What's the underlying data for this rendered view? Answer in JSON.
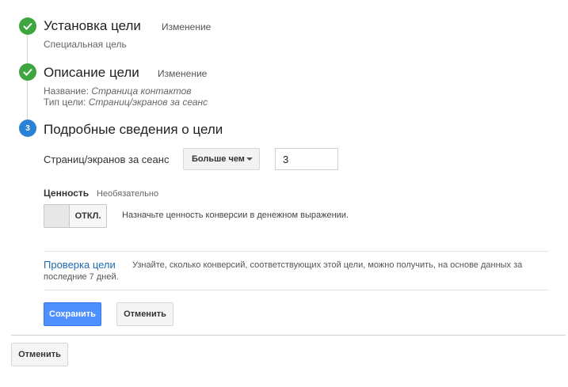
{
  "steps": [
    {
      "title": "Установка цели",
      "edit": "Изменение",
      "summary": "Специальная цель"
    },
    {
      "title": "Описание цели",
      "edit": "Изменение",
      "name_label": "Название:",
      "name_value": "Страница контактов",
      "type_label": "Тип цели:",
      "type_value": "Страниц/экранов за сеанс"
    },
    {
      "number": "3",
      "title": "Подробные сведения о цели"
    }
  ],
  "details": {
    "metric_label": "Страниц/экранов за сеанс",
    "operator": "Больше чем",
    "value": "3"
  },
  "value_section": {
    "label": "Ценность",
    "optional": "Необязательно",
    "toggle": "ОТКЛ.",
    "hint": "Назначьте ценность конверсии в денежном выражении."
  },
  "verify": {
    "link": "Проверка цели",
    "text_line1": "Узнайте, сколько конверсий, соответствующих этой цели, можно получить, на основе данных за",
    "text_line2": "последние 7 дней."
  },
  "buttons": {
    "save": "Сохранить",
    "cancel": "Отменить",
    "cancel_outer": "Отменить"
  },
  "colors": {
    "check_green": "#3fa63f",
    "step_blue": "#2a82d6",
    "primary_button": "#4d90fe",
    "link_blue": "#1f6ab0"
  }
}
